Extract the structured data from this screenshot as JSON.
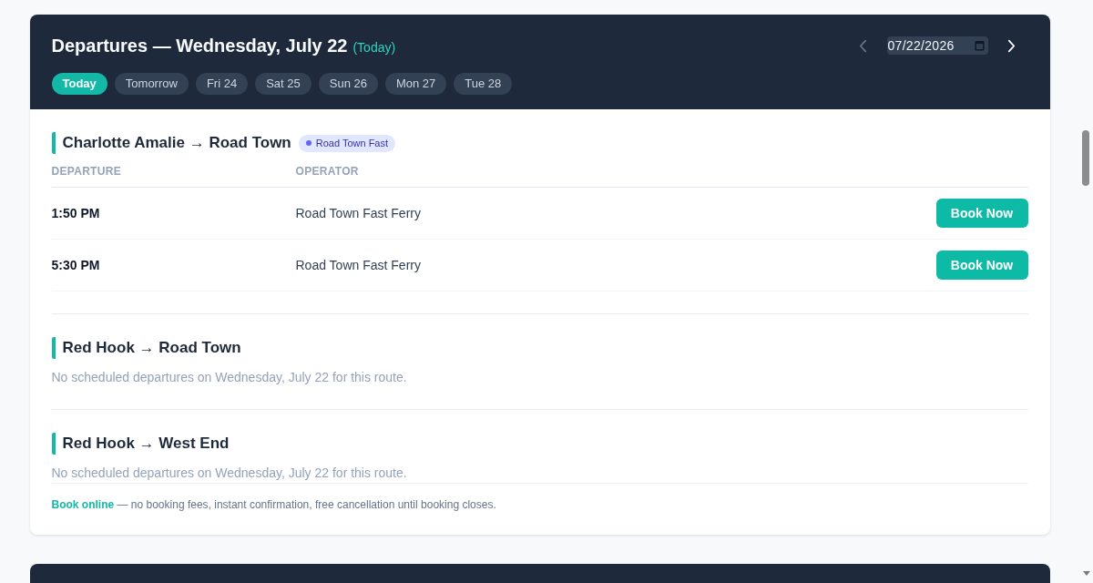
{
  "schedule": {
    "title": "Departures — Wednesday, July 22",
    "today_note": "(Today)",
    "date_nav": {
      "previous": {
        "disabled": true
      },
      "date": "07/22/2026",
      "next": {
        "disabled": false
      }
    },
    "day_tabs": [
      {
        "label": "Today",
        "selected": true
      },
      {
        "label": "Tomorrow",
        "selected": false
      },
      {
        "label": "Fri 24",
        "selected": false
      },
      {
        "label": "Sat 25",
        "selected": false
      },
      {
        "label": "Sun 26",
        "selected": false
      },
      {
        "label": "Mon 27",
        "selected": false
      },
      {
        "label": "Tue 28",
        "selected": false
      }
    ],
    "routes": [
      {
        "title": "Charlotte Amalie → Road Town",
        "badge": {
          "label": "Road Town Fast",
          "color": "#6366f1"
        },
        "columns": [
          "DEPARTURE",
          "OPERATOR"
        ],
        "departures": [
          {
            "time": "1:50 PM",
            "operator": "Road Town Fast Ferry",
            "action": "Book Now"
          },
          {
            "time": "5:30 PM",
            "operator": "Road Town Fast Ferry",
            "action": "Book Now"
          }
        ]
      },
      {
        "title": "Red Hook → Road Town",
        "empty_message": "No scheduled departures on Wednesday, July 22 for this route."
      },
      {
        "title": "Red Hook → West End",
        "empty_message": "No scheduled departures on Wednesday, July 22 for this route."
      }
    ],
    "footer": "**Book online** — no booking fees, instant confirmation, free cancellation until booking closes."
  }
}
